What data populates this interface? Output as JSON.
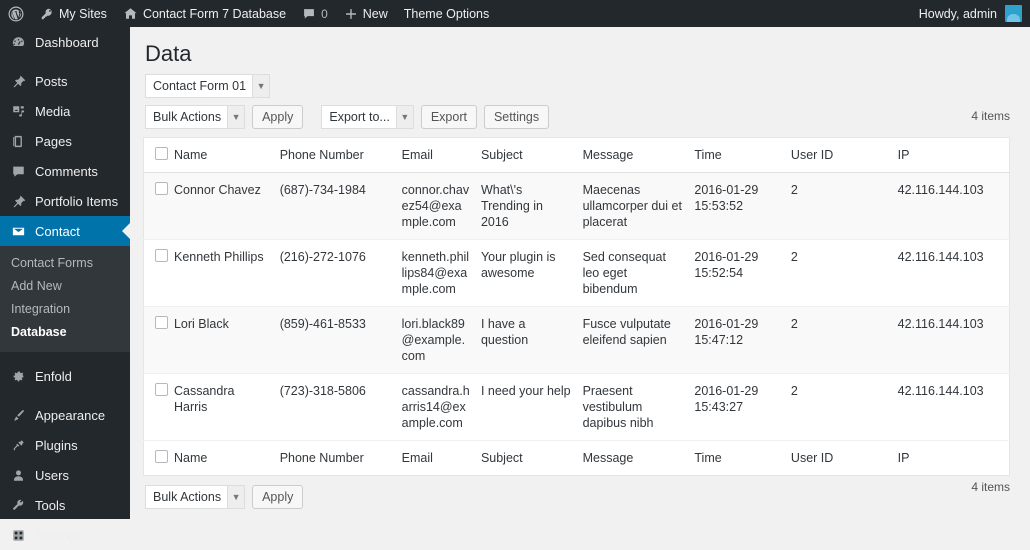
{
  "adminbar": {
    "logo_icon": "wordpress-logo-icon",
    "items": [
      {
        "icon": "key-icon",
        "label": "My Sites"
      },
      {
        "icon": "home-icon",
        "label": "Contact Form 7 Database"
      },
      {
        "icon": "comment-icon",
        "label": "0"
      },
      {
        "icon": "plus-icon",
        "label": "New"
      },
      {
        "icon": "",
        "label": "Theme Options"
      }
    ],
    "howdy": "Howdy, admin"
  },
  "sidebar": {
    "items": [
      {
        "label": "Dashboard",
        "icon": "dashboard-icon",
        "current": false,
        "gap": false
      },
      {
        "label": "Posts",
        "icon": "pin-icon",
        "current": false,
        "gap": true
      },
      {
        "label": "Media",
        "icon": "media-icon",
        "current": false,
        "gap": false
      },
      {
        "label": "Pages",
        "icon": "pages-icon",
        "current": false,
        "gap": false
      },
      {
        "label": "Comments",
        "icon": "comment-icon",
        "current": false,
        "gap": false
      },
      {
        "label": "Portfolio Items",
        "icon": "pin-icon",
        "current": false,
        "gap": false
      },
      {
        "label": "Contact",
        "icon": "envelope-icon",
        "current": true,
        "gap": false
      }
    ],
    "submenu": [
      {
        "label": "Contact Forms",
        "current": false
      },
      {
        "label": "Add New",
        "current": false
      },
      {
        "label": "Integration",
        "current": false
      },
      {
        "label": "Database",
        "current": true
      }
    ],
    "items_lower": [
      {
        "label": "Enfold",
        "icon": "gear-icon",
        "gap": true
      },
      {
        "label": "Appearance",
        "icon": "brush-icon",
        "gap": true
      },
      {
        "label": "Plugins",
        "icon": "plug-icon",
        "gap": false
      },
      {
        "label": "Users",
        "icon": "user-icon",
        "gap": false
      },
      {
        "label": "Tools",
        "icon": "wrench-icon",
        "gap": false
      },
      {
        "label": "Settings",
        "icon": "settings-icon",
        "gap": false
      }
    ],
    "accent_color": "#0073aa",
    "background_color": "#23282d"
  },
  "main": {
    "title": "Data",
    "form_select": {
      "value": "Contact Form 01"
    },
    "toolbar": {
      "bulk_actions": "Bulk Actions",
      "apply": "Apply",
      "export_to": "Export to...",
      "export": "Export",
      "settings": "Settings"
    },
    "items_count_top": "4 items",
    "items_count_bottom": "4 items",
    "table": {
      "columns": [
        "Name",
        "Phone Number",
        "Email",
        "Subject",
        "Message",
        "Time",
        "User ID",
        "IP"
      ],
      "rows": [
        {
          "name": "Connor Chavez",
          "phone": "(687)-734-1984",
          "email": "connor.chavez54@example.com",
          "subject": "What\\'s Trending in 2016",
          "message": "Maecenas ullamcorper dui et placerat",
          "time": "2016-01-29 15:53:52",
          "user_id": "2",
          "ip": "42.116.144.103"
        },
        {
          "name": "Kenneth Phillips",
          "phone": "(216)-272-1076",
          "email": "kenneth.phillips84@example.com",
          "subject": "Your plugin is awesome",
          "message": "Sed consequat leo eget bibendum",
          "time": "2016-01-29 15:52:54",
          "user_id": "2",
          "ip": "42.116.144.103"
        },
        {
          "name": "Lori Black",
          "phone": "(859)-461-8533",
          "email": "lori.black89@example.com",
          "subject": "I have a question",
          "message": "Fusce vulputate eleifend sapien",
          "time": "2016-01-29 15:47:12",
          "user_id": "2",
          "ip": "42.116.144.103"
        },
        {
          "name": "Cassandra Harris",
          "phone": "(723)-318-5806",
          "email": "cassandra.harris14@example.com",
          "subject": "I need your help",
          "message": "Praesent vestibulum dapibus nibh",
          "time": "2016-01-29 15:43:27",
          "user_id": "2",
          "ip": "42.116.144.103"
        }
      ]
    }
  }
}
